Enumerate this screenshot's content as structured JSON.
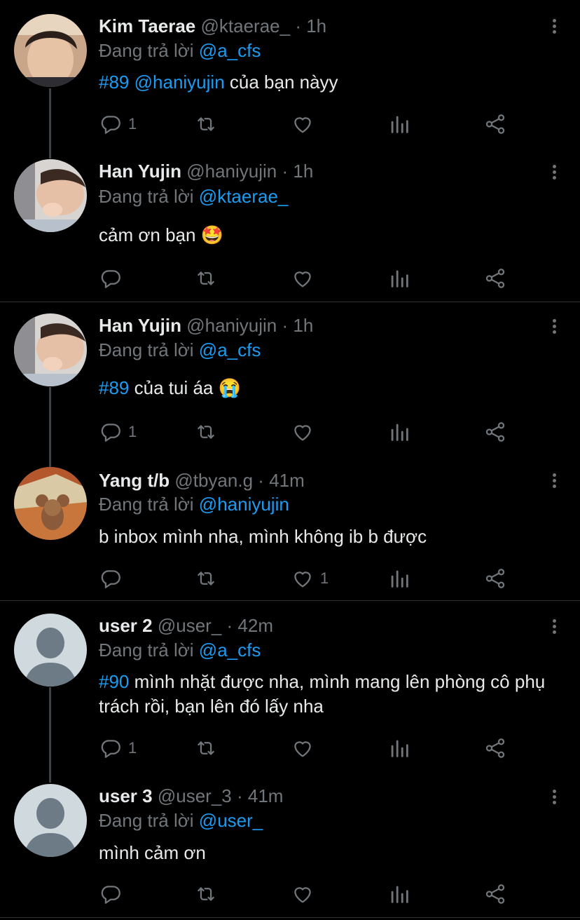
{
  "reply_prefix": "Đang trả lời",
  "tweets": [
    {
      "name": "Kim Taerae",
      "handle": "@ktaerae_",
      "sep": "·",
      "time": "1h",
      "reply_to": "@a_cfs",
      "hashtag": "#89",
      "mention": "@haniyujin",
      "text": "của bạn nàyy",
      "reply_count": "1",
      "like_count": ""
    },
    {
      "name": "Han Yujin",
      "handle": "@haniyujin",
      "sep": "·",
      "time": "1h",
      "reply_to": "@ktaerae_",
      "text": "cảm ơn bạn 🤩",
      "reply_count": "",
      "like_count": ""
    },
    {
      "name": "Han Yujin",
      "handle": "@haniyujin",
      "sep": "·",
      "time": "1h",
      "reply_to": "@a_cfs",
      "hashtag": "#89",
      "text": "của tui áa 😭",
      "reply_count": "1",
      "like_count": ""
    },
    {
      "name": "Yang t/b",
      "handle": "@tbyan.g",
      "sep": "·",
      "time": "41m",
      "reply_to": "@haniyujin",
      "text": "b inbox mình nha, mình không ib b được",
      "reply_count": "",
      "like_count": "1"
    },
    {
      "name": "user 2",
      "handle": "@user_",
      "sep": "·",
      "time": "42m",
      "reply_to": "@a_cfs",
      "hashtag": "#90",
      "text": "mình nhặt được nha, mình mang lên phòng cô phụ trách rồi, bạn lên đó lấy nha",
      "reply_count": "1",
      "like_count": ""
    },
    {
      "name": "user 3",
      "handle": "@user_3",
      "sep": "·",
      "time": "41m",
      "reply_to": "@user_",
      "text": "mình cảm ơn",
      "reply_count": "",
      "like_count": ""
    }
  ],
  "colors": {
    "background": "#000000",
    "link": "#1d9bf0",
    "muted": "#71767b",
    "text": "#e7e9ea"
  }
}
